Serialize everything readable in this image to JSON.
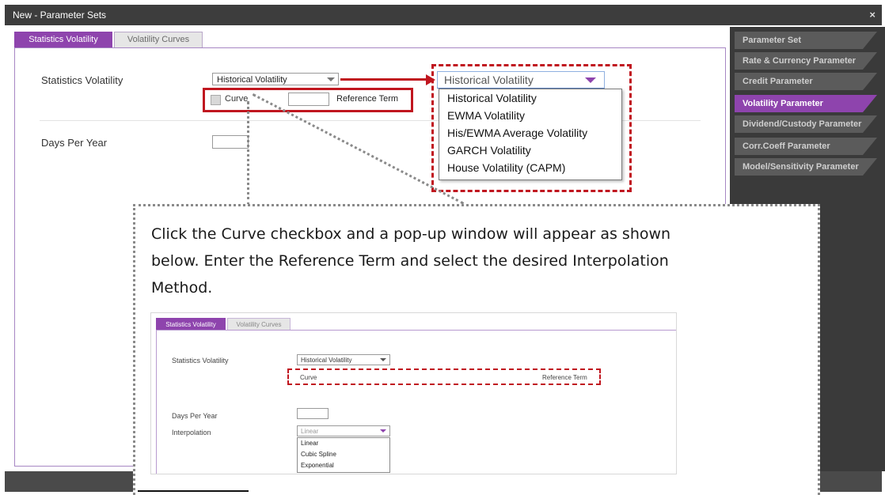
{
  "window": {
    "title": "New - Parameter Sets",
    "close_glyph": "×"
  },
  "tabs": [
    {
      "label": "Statistics Volatility",
      "active": true
    },
    {
      "label": "Volatility Curves",
      "active": false
    }
  ],
  "form": {
    "statistics_volatility_label": "Statistics Volatility",
    "statistics_volatility_value": "Historical Volatility",
    "curve_label": "Curve",
    "reference_term_label": "Reference Term",
    "days_per_year_label": "Days Per Year"
  },
  "zoom": {
    "selected": "Historical Volatility",
    "options": [
      "Historical Volatility",
      "EWMA Volatility",
      "His/EWMA Average Volatility",
      "GARCH Volatility",
      "House Volatility (CAPM)"
    ]
  },
  "sidebar": {
    "items": [
      {
        "label": "Parameter Set",
        "active": false
      },
      {
        "label": "Rate & Currency Parameter",
        "active": false
      },
      {
        "label": "Credit Parameter",
        "active": false
      },
      {
        "label": "Volatility Parameter",
        "active": true
      },
      {
        "label": "Dividend/Custody Parameter",
        "active": false
      },
      {
        "label": "Corr.Coeff Parameter",
        "active": false
      },
      {
        "label": "Model/Sensitivity Parameter",
        "active": false
      }
    ]
  },
  "callout": {
    "line1": "Click the Curve checkbox and a pop-up window will appear as shown",
    "line2": "below. Enter the Reference Term and select the desired Interpolation",
    "line3": "Method."
  },
  "mini": {
    "tabs": [
      "Statistics Volatility",
      "Volatility Curves"
    ],
    "statistics_volatility_label": "Statistics Volatility",
    "statistics_volatility_value": "Historical Volatility",
    "curve_label": "Curve",
    "reference_term_label": "Reference Term",
    "days_per_year_label": "Days Per Year",
    "interpolation_label": "Interpolation",
    "interpolation_value": "Linear",
    "interpolation_options": [
      "Linear",
      "Cubic Spline",
      "Exponential"
    ]
  },
  "colors": {
    "accent": "#8e44ad",
    "highlight_red": "#c0161f",
    "sidebar_bg": "#3a3a3a"
  }
}
